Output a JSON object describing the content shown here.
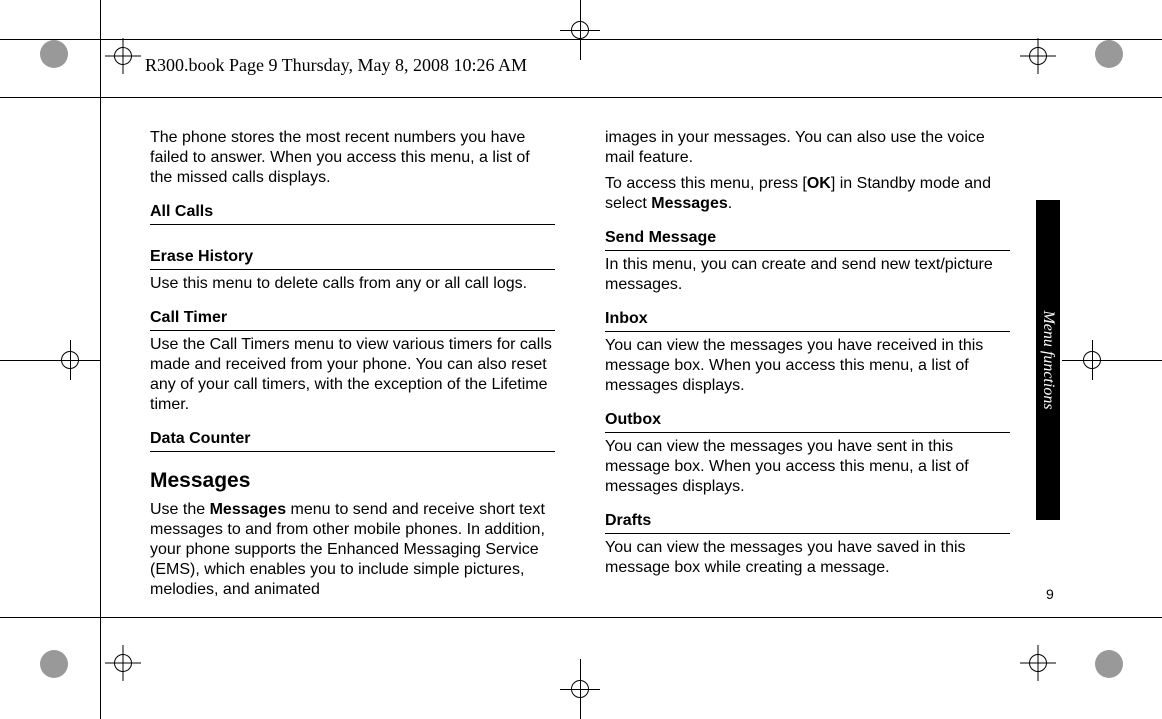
{
  "header": {
    "filename_line": "R300.book  Page 9  Thursday, May 8, 2008  10:26 AM"
  },
  "tab": {
    "label": "Menu functions"
  },
  "page_number": "9",
  "col1": {
    "intro": "The phone stores the most recent numbers you have failed to answer. When you access this menu, a list of the missed calls displays.",
    "all_calls": "All Calls",
    "erase_history": "Erase History",
    "erase_history_text": "Use this menu to delete calls from any or all call logs.",
    "call_timer": "Call Timer",
    "call_timer_text": "Use the Call Timers menu to view various timers for calls made and received from your phone. You can also reset any of your call timers, with the exception of the Lifetime timer.",
    "data_counter": "Data Counter",
    "messages_h": "Messages",
    "messages_p1a": "Use the ",
    "messages_p1b": "Messages",
    "messages_p1c": " menu to send and receive short text messages to and from other mobile phones. In addition, your phone supports the Enhanced Messaging Service (EMS), which enables you to include simple pictures, melodies, and animated"
  },
  "col2": {
    "messages_p2": "images in your messages. You can also use the voice mail feature.",
    "access_a": "To access this menu, press [",
    "access_b": "OK",
    "access_c": "] in Standby mode and select ",
    "access_d": "Messages",
    "access_e": ".",
    "send_message": "Send Message",
    "send_message_text": "In this menu, you can create and send new text/picture messages.",
    "inbox": "Inbox",
    "inbox_text": "You can view the messages you have received in this message box. When you access this menu, a list of messages displays.",
    "outbox": "Outbox",
    "outbox_text": "You can view the messages you have sent in this message box. When you access this menu, a list of messages displays.",
    "drafts": "Drafts",
    "drafts_text": "You can view the messages you have saved in this message box while creating a message."
  }
}
